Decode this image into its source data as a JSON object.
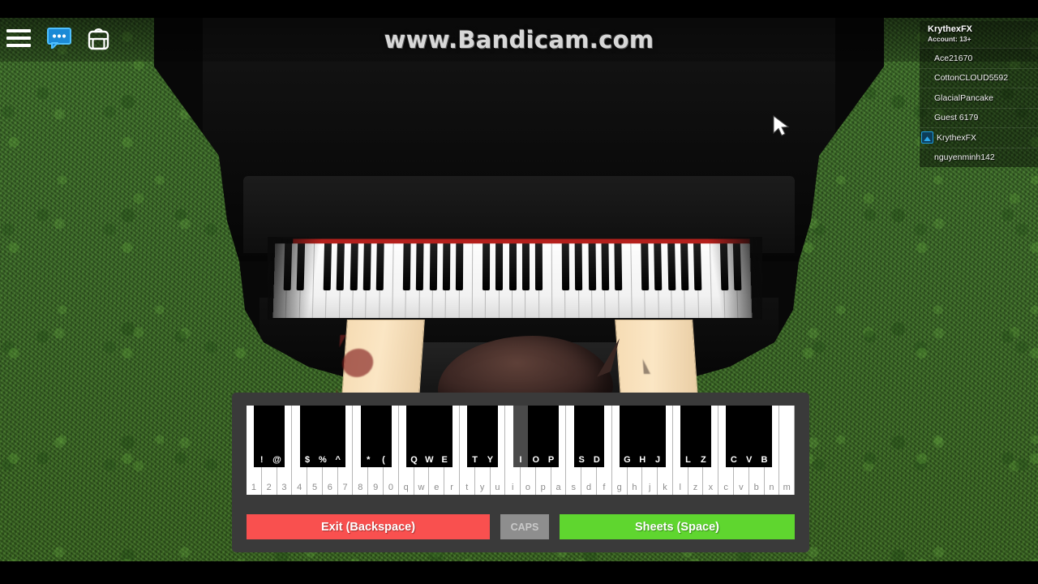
{
  "watermark": {
    "text": "www.Bandicam.com"
  },
  "topbar": {
    "icons": [
      {
        "name": "hamburger-menu-icon",
        "label": "Menu"
      },
      {
        "name": "chat-icon",
        "label": "Chat"
      },
      {
        "name": "backpack-icon",
        "label": "Backpack"
      }
    ]
  },
  "playerlist": {
    "local_player": "KrythexFX",
    "account_label": "Account: 13+",
    "players": [
      {
        "name": "Ace21670",
        "is_local": false
      },
      {
        "name": "CottonCLOUD5592",
        "is_local": false
      },
      {
        "name": "GlacialPancake",
        "is_local": false
      },
      {
        "name": "Guest 6179",
        "is_local": false
      },
      {
        "name": "KrythexFX",
        "is_local": true
      },
      {
        "name": "nguyenminh142",
        "is_local": false
      }
    ]
  },
  "keyboard": {
    "white_keys": [
      "1",
      "2",
      "3",
      "4",
      "5",
      "6",
      "7",
      "8",
      "9",
      "0",
      "q",
      "w",
      "e",
      "r",
      "t",
      "y",
      "u",
      "i",
      "o",
      "p",
      "a",
      "s",
      "d",
      "f",
      "g",
      "h",
      "j",
      "k",
      "l",
      "z",
      "x",
      "c",
      "v",
      "b",
      "n",
      "m"
    ],
    "black_keys": [
      {
        "label": "!",
        "after": 0,
        "highlighted": false
      },
      {
        "label": "@",
        "after": 1,
        "highlighted": false
      },
      {
        "label": "$",
        "after": 3,
        "highlighted": false
      },
      {
        "label": "%",
        "after": 4,
        "highlighted": false
      },
      {
        "label": "^",
        "after": 5,
        "highlighted": false
      },
      {
        "label": "*",
        "after": 7,
        "highlighted": false
      },
      {
        "label": "(",
        "after": 8,
        "highlighted": false
      },
      {
        "label": "Q",
        "after": 10,
        "highlighted": false
      },
      {
        "label": "W",
        "after": 11,
        "highlighted": false
      },
      {
        "label": "E",
        "after": 12,
        "highlighted": false
      },
      {
        "label": "T",
        "after": 14,
        "highlighted": false
      },
      {
        "label": "Y",
        "after": 15,
        "highlighted": false
      },
      {
        "label": "I",
        "after": 17,
        "highlighted": true
      },
      {
        "label": "O",
        "after": 18,
        "highlighted": false
      },
      {
        "label": "P",
        "after": 19,
        "highlighted": false
      },
      {
        "label": "S",
        "after": 21,
        "highlighted": false
      },
      {
        "label": "D",
        "after": 22,
        "highlighted": false
      },
      {
        "label": "G",
        "after": 24,
        "highlighted": false
      },
      {
        "label": "H",
        "after": 25,
        "highlighted": false
      },
      {
        "label": "J",
        "after": 26,
        "highlighted": false
      },
      {
        "label": "L",
        "after": 28,
        "highlighted": false
      },
      {
        "label": "Z",
        "after": 29,
        "highlighted": false
      },
      {
        "label": "C",
        "after": 31,
        "highlighted": false
      },
      {
        "label": "V",
        "after": 32,
        "highlighted": false
      },
      {
        "label": "B",
        "after": 33,
        "highlighted": false
      }
    ],
    "buttons": {
      "exit": "Exit (Backspace)",
      "caps": "CAPS",
      "sheets": "Sheets (Space)"
    }
  },
  "colors": {
    "exit_button": "#f9504f",
    "sheets_button": "#5fd62f",
    "caps_button": "#8e8e8e",
    "panel": "#3a3a3a",
    "grass": "#3b6c27",
    "piano_felt": "#b4201c",
    "avatar_accent": "#2ba7ea"
  }
}
